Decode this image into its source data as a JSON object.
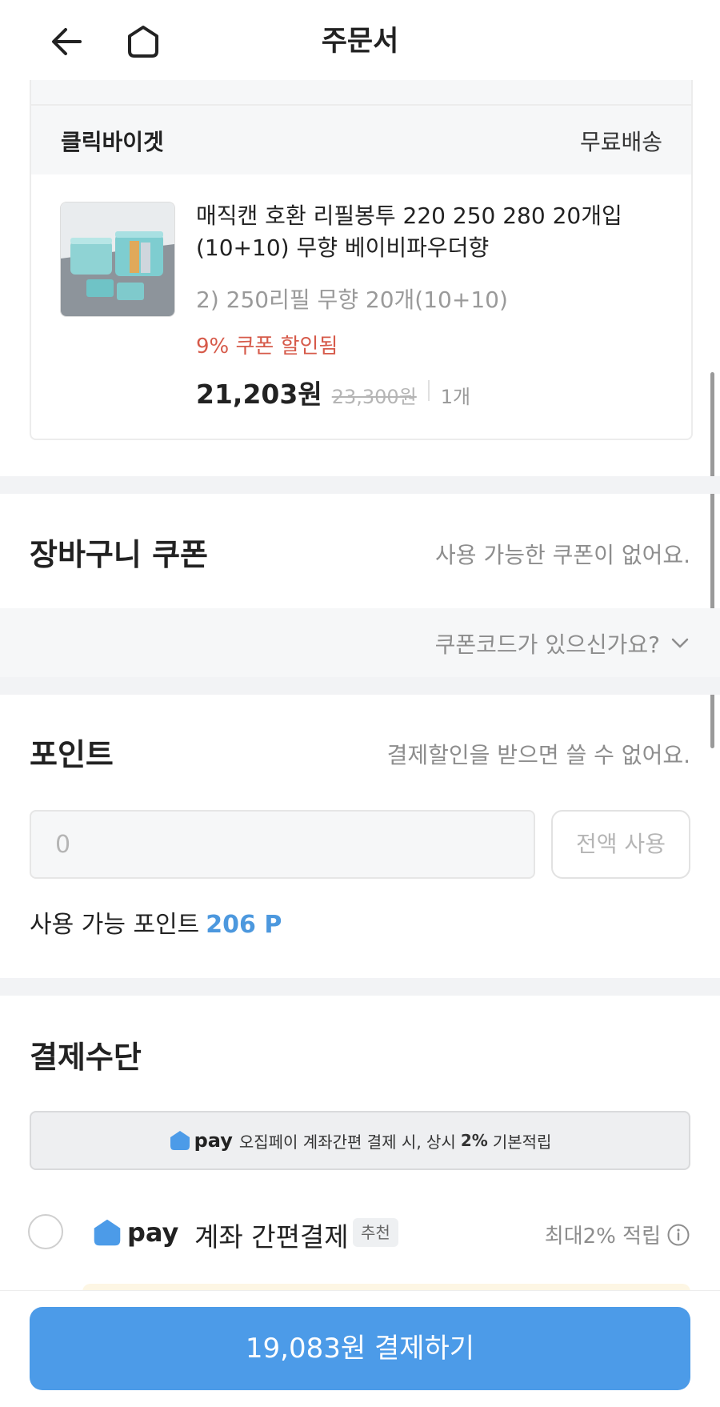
{
  "header": {
    "title": "주문서",
    "back_icon": "back-arrow-icon",
    "home_icon": "home-icon"
  },
  "order_item": {
    "seller": "클릭바이겟",
    "shipping": "무료배송",
    "product_name": "매직캔 호환 리필봉투 220 250 280 20개입 (10+10) 무향 베이비파우더향",
    "option": "2) 250리필 무향 20개(10+10)",
    "coupon_applied": "9% 쿠폰 할인됨",
    "sale_price": "21,203원",
    "original_price": "23,300원",
    "quantity": "1개"
  },
  "cart_coupon": {
    "title": "장바구니 쿠폰",
    "note": "사용 가능한 쿠폰이 없어요.",
    "code_prompt": "쿠폰코드가 있으신가요?"
  },
  "points": {
    "title": "포인트",
    "note": "결제할인을 받으면 쓸 수 없어요.",
    "input_value": "0",
    "use_all_label": "전액 사용",
    "available_label": "사용 가능 포인트",
    "available_value": "206 P"
  },
  "payment": {
    "title": "결제수단",
    "banner_pay": "pay",
    "banner_text": "오집페이 계좌간편 결제 시, 상시",
    "banner_rate": "2%",
    "banner_suffix": "기본적립",
    "option_pay": "pay",
    "option_label": "계좌 간편결제",
    "option_badge": "추천",
    "option_reward": "최대2% 적립"
  },
  "bottom": {
    "pay_button": "19,083원 결제하기"
  },
  "colors": {
    "accent": "#4c9be8",
    "points_accent": "#4c98de",
    "coupon_red": "#d65a4a"
  }
}
